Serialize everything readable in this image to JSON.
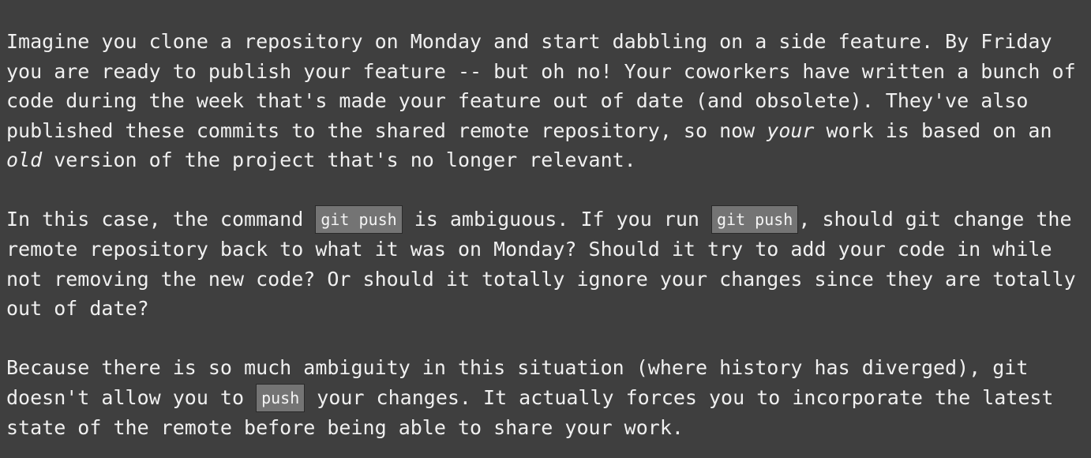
{
  "paragraphs": {
    "p1": {
      "t1": "Imagine you clone a repository on Monday and start dabbling on a side feature. By Friday you are ready to publish your feature -- but oh no! Your coworkers have written a bunch of code during the week that's made your feature out of date (and obsolete). They've also published these commits to the shared remote repository, so now ",
      "em1": "your",
      "t2": " work is based on an ",
      "em2": "old",
      "t3": " version of the project that's no longer relevant."
    },
    "p2": {
      "t1": "In this case, the command ",
      "code1": "git push",
      "t2": " is ambiguous. If you run ",
      "code2": "git push",
      "t3": ", should git change the remote repository back to what it was on Monday? Should it try to add your code in while not removing the new code? Or should it totally ignore your changes since they are totally out of date?"
    },
    "p3": {
      "t1": "Because there is so much ambiguity in this situation (where history has diverged), git doesn't allow you to ",
      "code1": "push",
      "t2": " your changes. It actually forces you to incorporate the latest state of the remote before being able to share your work."
    }
  }
}
